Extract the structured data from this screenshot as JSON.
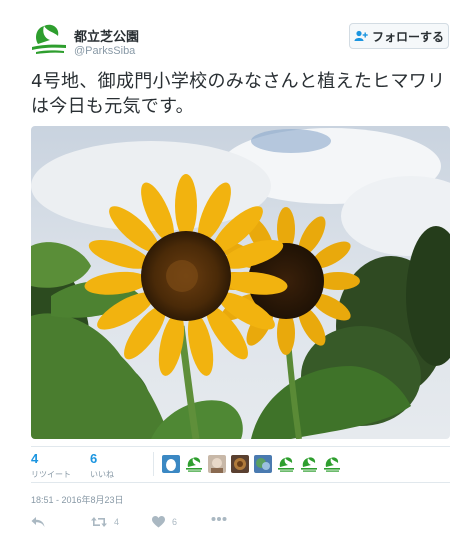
{
  "account": {
    "display_name": "都立芝公園",
    "handle": "@ParksSiba",
    "avatar_icon": "green-hand-leaf-logo-icon"
  },
  "follow_button": {
    "label": "フォローする",
    "icon": "add-user-icon"
  },
  "tweet": {
    "text": "4号地、御成門小学校のみなさんと植えたヒマワリは今日も元気です。",
    "photo_icon": "sunflower-photo"
  },
  "stats": {
    "retweets": {
      "count": "4",
      "label": "リツイート"
    },
    "likes": {
      "count": "6",
      "label": "いいね"
    }
  },
  "likers": [
    "blue-egg-avatar",
    "green-leaf-avatar",
    "photo-avatar",
    "photo-avatar",
    "photo-avatar",
    "green-leaf-avatar",
    "green-leaf-avatar",
    "green-leaf-avatar"
  ],
  "timestamp": "18:51 - 2016年8月23日",
  "actions": {
    "reply_icon": "reply-icon",
    "retweet_icon": "retweet-icon",
    "retweet_count": "4",
    "like_icon": "heart-icon",
    "like_count": "6",
    "more_icon": "more-dots-icon"
  },
  "colors": {
    "link_blue": "#1b95e0",
    "muted": "#8899a6",
    "text": "#292f33",
    "brand_green": "#2e9e2e"
  }
}
